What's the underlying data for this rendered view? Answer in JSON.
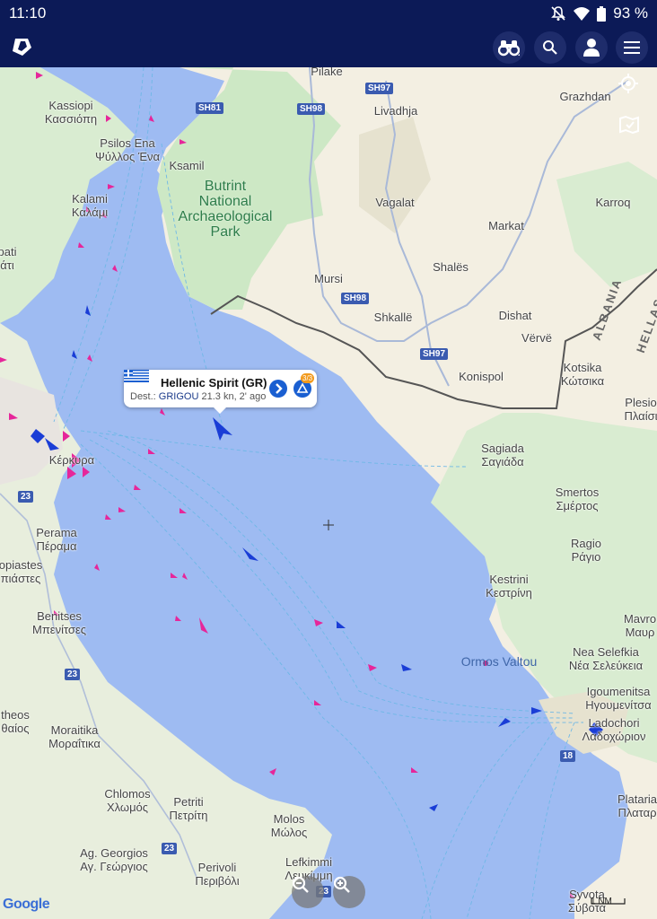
{
  "status": {
    "time": "11:10",
    "battery": "93 %"
  },
  "appbar": {
    "logo": "logo-icon",
    "actions": [
      {
        "name": "binoculars-icon"
      },
      {
        "name": "search-icon"
      },
      {
        "name": "account-icon"
      },
      {
        "name": "menu-icon"
      }
    ]
  },
  "map": {
    "labels": {
      "pilake": "Pilake",
      "grazhdan": "Grazhdan",
      "livadhja": "Livadhja",
      "kassiopi": "Kassiopi\nΚασσιόπη",
      "psilos_ena": "Psilos Ena\nΨύλλος Ένα",
      "ksamil": "Ksamil",
      "kalami": "Kalami\nΚαλάμι",
      "butrint": "Butrint\nNational\nArchaeological\nPark",
      "vagalat": "Vagalat",
      "karroq": "Karroq",
      "markat": "Markat",
      "pati": "pati\nάτι",
      "shales": "Shalës",
      "mursi": "Mursi",
      "shkalle": "Shkallë",
      "dishat": "Dishat",
      "verve": "Vërvë",
      "konispol": "Konispol",
      "kotsika": "Kotsika\nΚώτσικα",
      "plesio": "Plesio\nΠλαίσι",
      "kerkyra": "Κέρκυρα",
      "sagiada": "Sagiada\nΣαγιάδα",
      "smertos": "Smertos\nΣμέρτος",
      "perama": "Perama\nΠέραμα",
      "ragio": "Ragio\nΡάγιο",
      "opiastes": "opiastes\nπιάστες",
      "kestrini": "Kestrini\nΚεστρίνη",
      "benitses": "Benitses\nΜπενίτσες",
      "mavro": "Mavro\nΜαυρ",
      "nea_selefkia": "Nea Selefkia\nΝέα Σελεύκεια",
      "ormos_valtou": "Ormos Valtou",
      "igoumenitsa": "Igoumenitsa\nΗγουμενίτσα",
      "ladochori": "Ladochori\nΛαδοχώριον",
      "theos": "theos\nθαίος",
      "moraitika": "Moraitika\nΜοραΐτικα",
      "chlomos": "Chlomos\nΧλωμός",
      "petriti": "Petriti\nΠετρίτη",
      "molos": "Molos\nΜώλος",
      "plataria": "Plataria\nΠλαταρ",
      "ag_georgios": "Ag. Georgios\nΑγ. Γεώργιος",
      "perivoli": "Perivoli\nΠεριβόλι",
      "lefkimmi": "Lefkimmi\nΛευκίμμη",
      "syvota": "Syvota\nΣύβοτα"
    },
    "roads": {
      "sh97a": "SH97",
      "sh98a": "SH98",
      "sh81": "SH81",
      "sh98b": "SH98",
      "sh97b": "SH97",
      "r23a": "23",
      "r23b": "23",
      "r23c": "23",
      "r23d": "23",
      "r18": "18"
    },
    "countries": {
      "albania": "ALBANIA",
      "hellas": "HELLAS"
    },
    "popup": {
      "vessel": "Hellenic Spirit (GR)",
      "dest_label": "Dest.:",
      "dest": "GRIGOU",
      "info": "21.3 kn, 2' ago",
      "count": "3/3"
    },
    "attribution": "Google",
    "scale": "1 NM"
  }
}
